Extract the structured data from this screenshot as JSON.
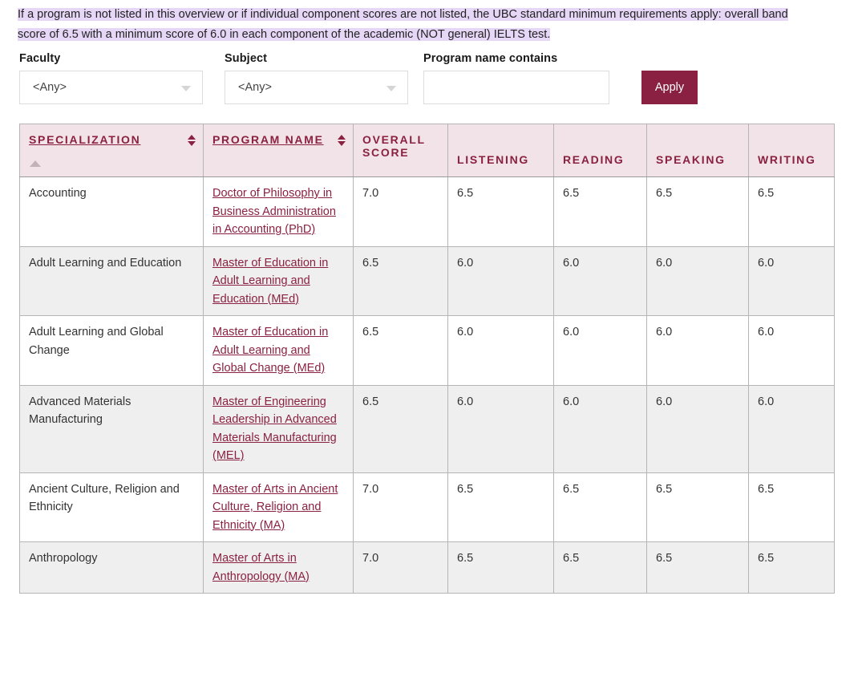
{
  "notice": {
    "text": "If a program is not listed in this overview or if individual component scores are not listed, the UBC standard minimum requirements apply: overall band score of 6.5 with a minimum score of 6.0 in each component of the academic (NOT general) IELTS test.",
    "highlight_color": "#e6d7f7"
  },
  "filters": {
    "faculty": {
      "label": "Faculty",
      "value": "<Any>",
      "icon": "chevron-down-icon"
    },
    "subject": {
      "label": "Subject",
      "value": "<Any>",
      "icon": "chevron-down-icon"
    },
    "program_name": {
      "label": "Program name contains",
      "value": "",
      "placeholder": ""
    },
    "apply_label": "Apply",
    "apply_color": "#8b2142"
  },
  "table": {
    "header_bg": "#f1e3e7",
    "header_text_color": "#8b2142",
    "link_color": "#8b2142",
    "stripe_color": "#efefef",
    "sort": {
      "column": "SPECIALIZATION",
      "direction": "ascending",
      "indicator": "sort-asc-icon"
    },
    "columns": [
      {
        "key": "specialization",
        "label": "SPECIALIZATION",
        "sortable": true,
        "sort_icon": "sort-toggle-icon"
      },
      {
        "key": "program_name",
        "label": "PROGRAM NAME",
        "sortable": true,
        "sort_icon": "sort-toggle-icon"
      },
      {
        "key": "overall",
        "label": "OVERALL SCORE",
        "sortable": false
      },
      {
        "key": "listening",
        "label": "LISTENING",
        "sortable": false
      },
      {
        "key": "reading",
        "label": "READING",
        "sortable": false
      },
      {
        "key": "speaking",
        "label": "SPEAKING",
        "sortable": false
      },
      {
        "key": "writing",
        "label": "WRITING",
        "sortable": false
      }
    ],
    "rows": [
      {
        "specialization": "Accounting",
        "program_name": "Doctor of Philosophy in Business Administration in Accounting (PhD)",
        "overall": "7.0",
        "listening": "6.5",
        "reading": "6.5",
        "speaking": "6.5",
        "writing": "6.5"
      },
      {
        "specialization": "Adult Learning and Education",
        "program_name": "Master of Education in Adult Learning and Education (MEd)",
        "overall": "6.5",
        "listening": "6.0",
        "reading": "6.0",
        "speaking": "6.0",
        "writing": "6.0"
      },
      {
        "specialization": "Adult Learning and Global Change",
        "program_name": "Master of Education in Adult Learning and Global Change (MEd)",
        "overall": "6.5",
        "listening": "6.0",
        "reading": "6.0",
        "speaking": "6.0",
        "writing": "6.0"
      },
      {
        "specialization": "Advanced Materials Manufacturing",
        "program_name": "Master of Engineering Leadership in Advanced Materials Manufacturing (MEL)",
        "overall": "6.5",
        "listening": "6.0",
        "reading": "6.0",
        "speaking": "6.0",
        "writing": "6.0"
      },
      {
        "specialization": "Ancient Culture, Religion and Ethnicity",
        "program_name": "Master of Arts in Ancient Culture, Religion and Ethnicity (MA)",
        "overall": "7.0",
        "listening": "6.5",
        "reading": "6.5",
        "speaking": "6.5",
        "writing": "6.5"
      },
      {
        "specialization": "Anthropology",
        "program_name": "Master of Arts in Anthropology (MA)",
        "overall": "7.0",
        "listening": "6.5",
        "reading": "6.5",
        "speaking": "6.5",
        "writing": "6.5"
      }
    ]
  }
}
